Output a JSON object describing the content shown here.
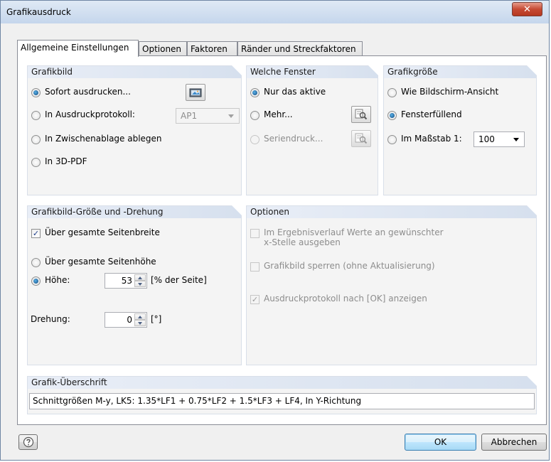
{
  "window": {
    "title": "Grafikausdruck"
  },
  "tabs": [
    {
      "label": "Allgemeine Einstellungen"
    },
    {
      "label": "Optionen"
    },
    {
      "label": "Faktoren"
    },
    {
      "label": "Ränder und Streckfaktoren"
    }
  ],
  "grafikbild": {
    "title": "Grafikbild",
    "options": [
      {
        "label": "Sofort ausdrucken...",
        "checked": true
      },
      {
        "label": "In Ausdruckprotokoll:",
        "checked": false
      },
      {
        "label": "In Zwischenablage ablegen",
        "checked": false
      },
      {
        "label": "In 3D-PDF",
        "checked": false
      }
    ],
    "protocol_select": "AP1"
  },
  "welche_fenster": {
    "title": "Welche Fenster",
    "options": [
      {
        "label": "Nur das aktive",
        "checked": true
      },
      {
        "label": "Mehr...",
        "checked": false
      },
      {
        "label": "Seriendruck...",
        "checked": false,
        "disabled": true
      }
    ]
  },
  "grafikgroesse": {
    "title": "Grafikgröße",
    "options": [
      {
        "label": "Wie Bildschirm-Ansicht",
        "checked": false
      },
      {
        "label": "Fensterfüllend",
        "checked": true
      },
      {
        "label": "Im Maßstab 1:",
        "checked": false
      }
    ],
    "scale_value": "100"
  },
  "groesse_drehung": {
    "title": "Grafikbild-Größe und -Drehung",
    "page_width_label": "Über gesamte Seitenbreite",
    "page_width_checked": true,
    "page_height_label": "Über gesamte Seitenhöhe",
    "height_label": "Höhe:",
    "height_value": "53",
    "height_unit": "[% der Seite]",
    "rotation_label": "Drehung:",
    "rotation_value": "0",
    "rotation_unit": "[°]"
  },
  "optionen": {
    "title": "Optionen",
    "items": [
      {
        "label": "Im Ergebnisverlauf Werte an gewünschter",
        "label2": "x-Stelle ausgeben",
        "checked": false
      },
      {
        "label": "Grafikbild sperren (ohne Aktualisierung)",
        "checked": false
      },
      {
        "label": "Ausdruckprotokoll nach [OK] anzeigen",
        "checked": true
      }
    ]
  },
  "ueberschrift": {
    "title": "Grafik-Überschrift",
    "value": "Schnittgrößen M-y, LK5: 1.35*LF1 + 0.75*LF2 + 1.5*LF3 + LF4, In Y-Richtung"
  },
  "footer": {
    "ok_label": "OK",
    "cancel_label": "Abbrechen"
  },
  "colors": {
    "accent": "#3c7fb1",
    "group_header": "#d6e0ee",
    "close_button": "#c64a33"
  }
}
